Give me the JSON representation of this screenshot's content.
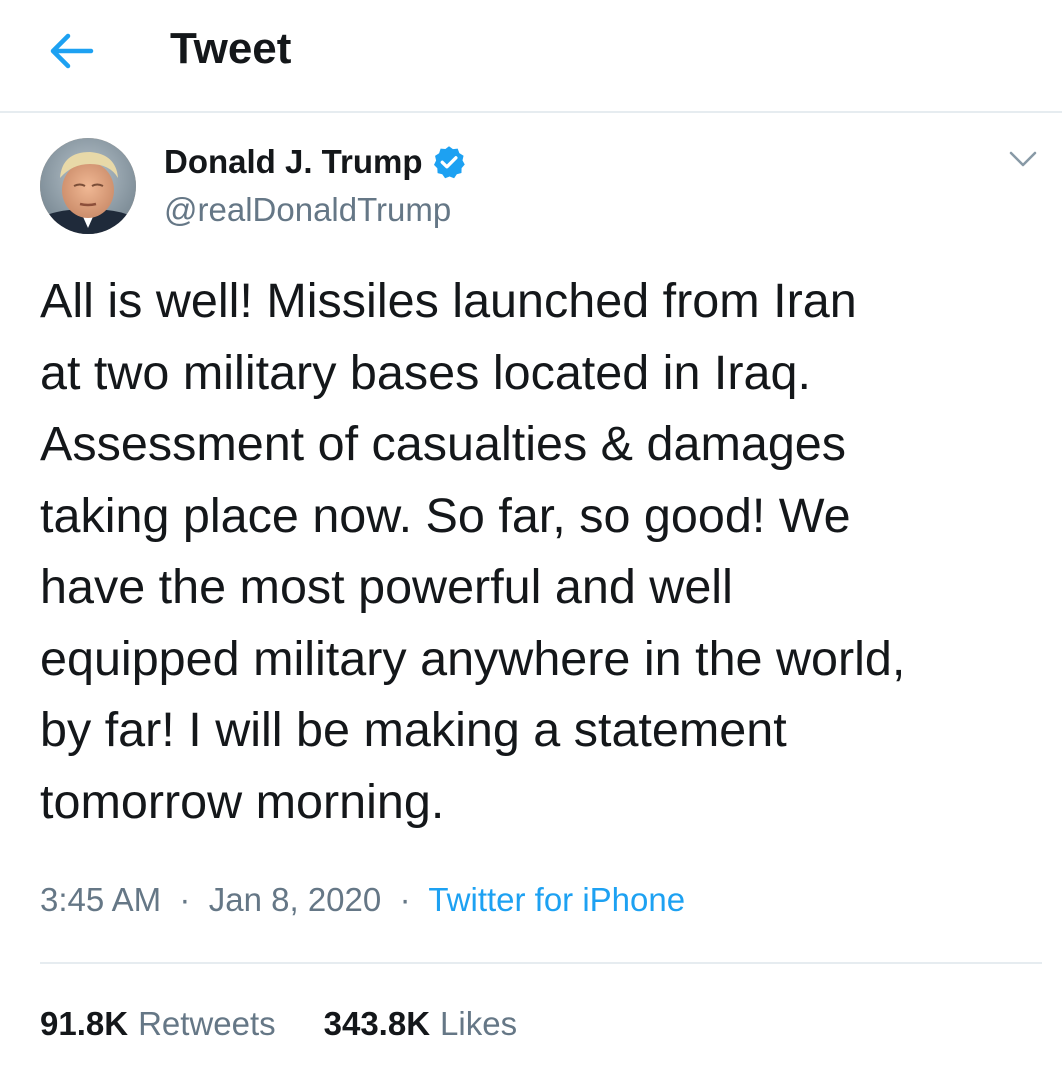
{
  "header": {
    "back_icon": "arrow-left-icon",
    "title": "Tweet",
    "accent_color": "#1da1f2"
  },
  "tweet": {
    "author": {
      "name": "Donald J. Trump",
      "handle": "@realDonaldTrump",
      "verified_icon": "verified-badge-icon",
      "avatar": "avatar-photo"
    },
    "menu_icon": "chevron-down-icon",
    "text_lines": [
      "All is well! Missiles launched from Iran",
      "at two military bases located in Iraq.",
      "Assessment of casualties & damages",
      "taking place now. So far, so good! We",
      "have the most powerful and well",
      "equipped military anywhere in the world,",
      "by far! I will be making a statement",
      "tomorrow morning."
    ],
    "time": "3:45 AM",
    "separator": "·",
    "date": "Jan 8, 2020",
    "source": "Twitter for iPhone",
    "stats": {
      "retweets_count": "91.8K",
      "retweets_label": "Retweets",
      "likes_count": "343.8K",
      "likes_label": "Likes"
    }
  }
}
